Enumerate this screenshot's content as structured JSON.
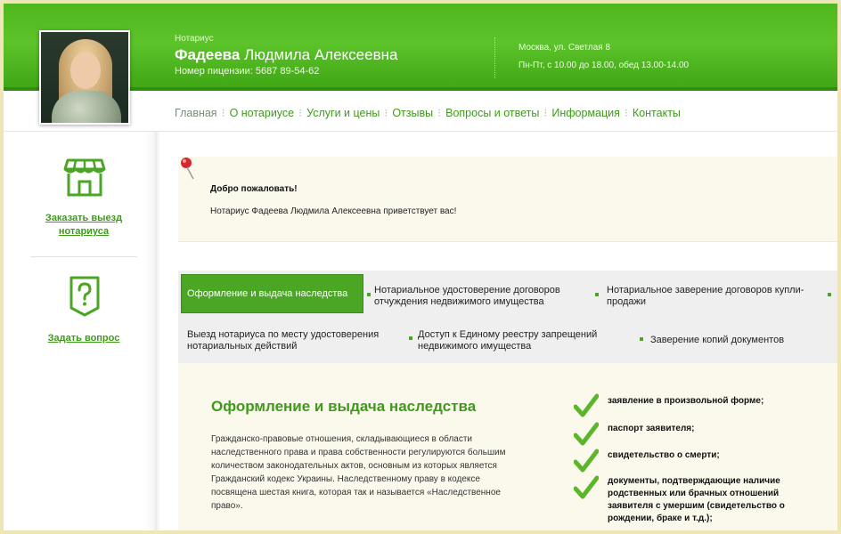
{
  "header": {
    "role": "Нотариус",
    "name_bold": "Фадеева",
    "name_rest": " Людмила Алексеевна",
    "license": "Номер пицензии: 5687 89-54-62",
    "address": "Москва, ул. Светлая 8",
    "hours": "Пн-Пт, с 10.00 до 18.00, обед 13.00-14.00"
  },
  "nav": {
    "items": [
      "Главная",
      "О нотариусе",
      "Услуги и цены",
      "Отзывы",
      "Вопросы и ответы",
      "Информация",
      "Контакты"
    ],
    "separator": "⁝"
  },
  "sidebar": {
    "order_visit": "Заказать выезд нотариуса",
    "order_visit_line1": "Заказать выезд",
    "order_visit_line2": "нотариуса",
    "ask_question": "Задать вопрос"
  },
  "welcome": {
    "title": "Добро пожаловать!",
    "text": "Нотариус Фадеева Людмила Алексеевна приветствует вас!"
  },
  "tabs": [
    {
      "line1": "Оформление и выдача наследства",
      "line2": ""
    },
    {
      "line1": "Нотариальное удостоверение договоров",
      "line2": "отчуждения недвижимого имущества"
    },
    {
      "line1": "Нотариальное заверение договоров купли-",
      "line2": "продажи"
    },
    {
      "line1": "Выезд нотариуса по месту удостоверения",
      "line2": "нотариальных действий"
    },
    {
      "line1": "Доступ к Единому реестру запрещений",
      "line2": "недвижимого имущества"
    },
    {
      "line1": "Заверение копий документов",
      "line2": ""
    }
  ],
  "content": {
    "title": "Оформление и выдача наследства",
    "body": "Гражданско-правовые отношения, складывающиеся в области наследственного права и права собственности регулируются большим количеством законодательных актов, основным из которых является Гражданский кодекс Украины. Наследственному праву в кодексе посвящена шестая книга, которая так и называется «Наследственное право».",
    "requirements": [
      "заявление в произвольной форме;",
      "паспорт заявителя;",
      "свидетельство о смерти;",
      "документы, подтверждающие наличие родственных или брачных отношений заявителя с умершим (свидетельство о рождении, браке и т.д.);"
    ]
  },
  "colors": {
    "brand_green": "#4aa623",
    "link_green": "#3f9a1c",
    "welcome_bg": "#fbf9ec"
  },
  "icons": [
    "storefront-icon",
    "question-badge-icon",
    "map-pin-icon",
    "checkmark-icon"
  ]
}
